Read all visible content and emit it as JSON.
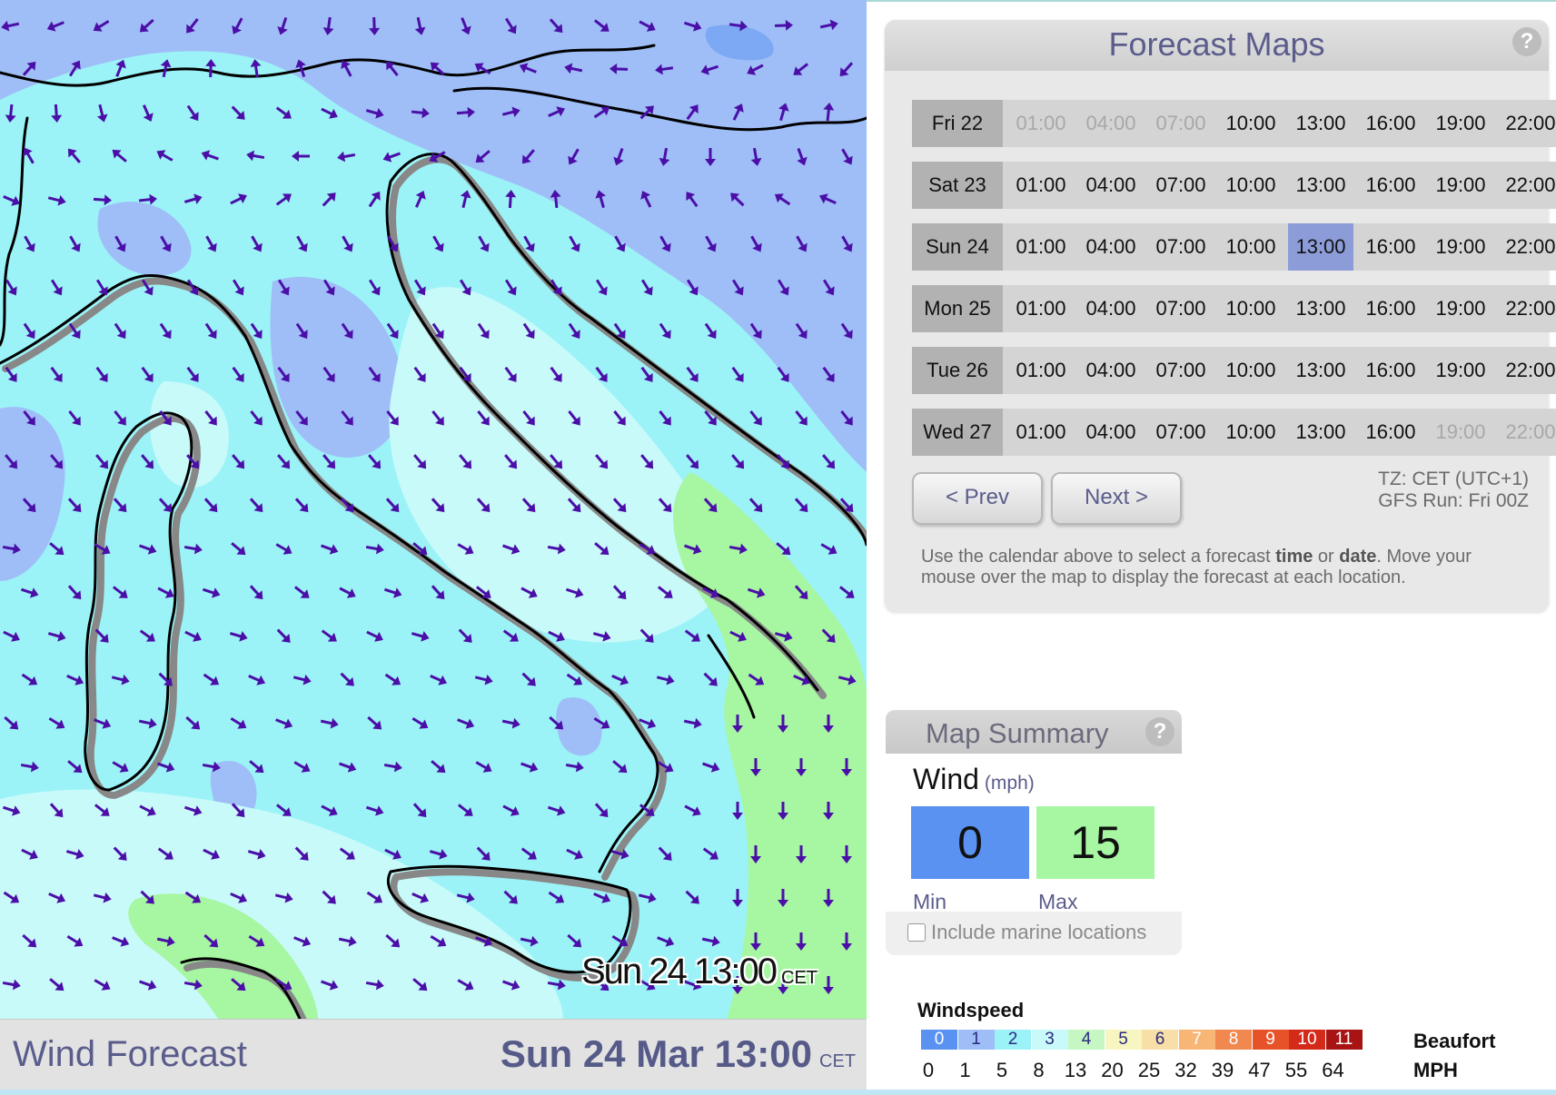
{
  "map": {
    "stamp_time": "Sun 24 13:00",
    "stamp_tz": "CET",
    "footer_title": "Wind Forecast",
    "footer_time": "Sun 24 Mar 13:00",
    "footer_tz": "CET"
  },
  "forecast": {
    "title": "Forecast Maps",
    "help": "?",
    "days": [
      {
        "label": "Fri 22",
        "slots": [
          {
            "t": "01:00",
            "state": "disabled"
          },
          {
            "t": "04:00",
            "state": "disabled"
          },
          {
            "t": "07:00",
            "state": "disabled"
          },
          {
            "t": "10:00",
            "state": "normal"
          },
          {
            "t": "13:00",
            "state": "normal"
          },
          {
            "t": "16:00",
            "state": "normal"
          },
          {
            "t": "19:00",
            "state": "normal"
          },
          {
            "t": "22:00",
            "state": "normal"
          }
        ]
      },
      {
        "label": "Sat 23",
        "slots": [
          {
            "t": "01:00",
            "state": "normal"
          },
          {
            "t": "04:00",
            "state": "normal"
          },
          {
            "t": "07:00",
            "state": "normal"
          },
          {
            "t": "10:00",
            "state": "normal"
          },
          {
            "t": "13:00",
            "state": "normal"
          },
          {
            "t": "16:00",
            "state": "normal"
          },
          {
            "t": "19:00",
            "state": "normal"
          },
          {
            "t": "22:00",
            "state": "normal"
          }
        ]
      },
      {
        "label": "Sun 24",
        "slots": [
          {
            "t": "01:00",
            "state": "normal"
          },
          {
            "t": "04:00",
            "state": "normal"
          },
          {
            "t": "07:00",
            "state": "normal"
          },
          {
            "t": "10:00",
            "state": "normal"
          },
          {
            "t": "13:00",
            "state": "selected"
          },
          {
            "t": "16:00",
            "state": "normal"
          },
          {
            "t": "19:00",
            "state": "normal"
          },
          {
            "t": "22:00",
            "state": "normal"
          }
        ]
      },
      {
        "label": "Mon 25",
        "slots": [
          {
            "t": "01:00",
            "state": "normal"
          },
          {
            "t": "04:00",
            "state": "normal"
          },
          {
            "t": "07:00",
            "state": "normal"
          },
          {
            "t": "10:00",
            "state": "normal"
          },
          {
            "t": "13:00",
            "state": "normal"
          },
          {
            "t": "16:00",
            "state": "normal"
          },
          {
            "t": "19:00",
            "state": "normal"
          },
          {
            "t": "22:00",
            "state": "normal"
          }
        ]
      },
      {
        "label": "Tue 26",
        "slots": [
          {
            "t": "01:00",
            "state": "normal"
          },
          {
            "t": "04:00",
            "state": "normal"
          },
          {
            "t": "07:00",
            "state": "normal"
          },
          {
            "t": "10:00",
            "state": "normal"
          },
          {
            "t": "13:00",
            "state": "normal"
          },
          {
            "t": "16:00",
            "state": "normal"
          },
          {
            "t": "19:00",
            "state": "normal"
          },
          {
            "t": "22:00",
            "state": "normal"
          }
        ]
      },
      {
        "label": "Wed 27",
        "slots": [
          {
            "t": "01:00",
            "state": "normal"
          },
          {
            "t": "04:00",
            "state": "normal"
          },
          {
            "t": "07:00",
            "state": "normal"
          },
          {
            "t": "10:00",
            "state": "normal"
          },
          {
            "t": "13:00",
            "state": "normal"
          },
          {
            "t": "16:00",
            "state": "normal"
          },
          {
            "t": "19:00",
            "state": "disabled"
          },
          {
            "t": "22:00",
            "state": "disabled"
          }
        ]
      }
    ],
    "prev_label": "< Prev",
    "next_label": "Next >",
    "tz": "TZ: CET (UTC+1)",
    "gfs_run": "GFS Run: Fri 00Z",
    "help_text_1": "Use the calendar above to select a forecast ",
    "help_text_bold_1": "time",
    "help_text_2": " or ",
    "help_text_bold_2": "date",
    "help_text_3": ". Move your mouse over the map to display the forecast at each location."
  },
  "summary": {
    "title": "Map Summary",
    "help": "?",
    "wind_label": "Wind",
    "wind_unit": "(mph)",
    "min_value": "0",
    "max_value": "15",
    "min_label": "Min",
    "max_label": "Max",
    "marine_label": "Include marine locations",
    "marine_checked": false,
    "min_color": "#5a92f2",
    "max_color": "#a6f6a2"
  },
  "legend": {
    "title": "Windspeed",
    "beaufort_label": "Beaufort",
    "mph_label": "MPH",
    "beaufort": [
      {
        "n": "0",
        "bg": "#5a92f2",
        "fg": "#ffffff"
      },
      {
        "n": "1",
        "bg": "#9fbef7",
        "fg": "#2a2a80"
      },
      {
        "n": "2",
        "bg": "#9cf3f7",
        "fg": "#2a2a80"
      },
      {
        "n": "3",
        "bg": "#c8fafa",
        "fg": "#2a2a80"
      },
      {
        "n": "4",
        "bg": "#c6f6c2",
        "fg": "#2a2a80"
      },
      {
        "n": "5",
        "bg": "#f8f6c0",
        "fg": "#2a2a80"
      },
      {
        "n": "6",
        "bg": "#f8dfa8",
        "fg": "#2a2a80"
      },
      {
        "n": "7",
        "bg": "#f8b676",
        "fg": "#ffffff"
      },
      {
        "n": "8",
        "bg": "#f08850",
        "fg": "#ffffff"
      },
      {
        "n": "9",
        "bg": "#e85228",
        "fg": "#ffffff"
      },
      {
        "n": "10",
        "bg": "#d42a1a",
        "fg": "#ffffff"
      },
      {
        "n": "11",
        "bg": "#a81414",
        "fg": "#ffffff"
      }
    ],
    "mph": [
      "0",
      "1",
      "5",
      "8",
      "13",
      "20",
      "25",
      "32",
      "39",
      "47",
      "55",
      "64"
    ]
  }
}
